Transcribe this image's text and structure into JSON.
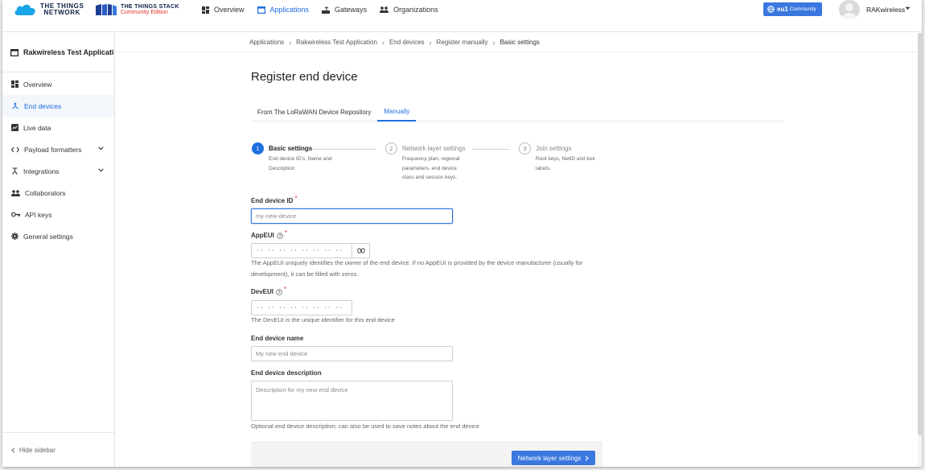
{
  "header": {
    "logo_ttn": [
      "THE THINGS",
      "NETWORK"
    ],
    "logo_tts": [
      "THE THINGS STACK",
      "Community Edition"
    ],
    "nav": [
      {
        "label": "Overview",
        "icon": "grid-icon"
      },
      {
        "label": "Applications",
        "icon": "application-icon",
        "active": true
      },
      {
        "label": "Gateways",
        "icon": "gateway-icon"
      },
      {
        "label": "Organizations",
        "icon": "organizations-icon"
      }
    ],
    "cluster_badge": {
      "region": "eu1",
      "label": "Community"
    },
    "user_name": "RAKwireless"
  },
  "sidebar": {
    "app_title": "Rakwireless Test Applicati...",
    "items": [
      {
        "label": "Overview",
        "icon": "grid-icon"
      },
      {
        "label": "End devices",
        "icon": "device-icon",
        "active": true
      },
      {
        "label": "Live data",
        "icon": "live-data-icon"
      },
      {
        "label": "Payload formatters",
        "icon": "code-icon",
        "expandable": true
      },
      {
        "label": "Integrations",
        "icon": "integrations-icon",
        "expandable": true
      },
      {
        "label": "Collaborators",
        "icon": "collaborators-icon"
      },
      {
        "label": "API keys",
        "icon": "key-icon"
      },
      {
        "label": "General settings",
        "icon": "gear-icon"
      }
    ],
    "hide_label": "Hide sidebar"
  },
  "breadcrumbs": [
    "Applications",
    "Rakwireless Test Application",
    "End devices",
    "Register manually",
    "Basic settings"
  ],
  "page_title": "Register end device",
  "tabs": [
    {
      "label": "From The LoRaWAN Device Repository"
    },
    {
      "label": "Manually",
      "active": true
    }
  ],
  "steps": [
    {
      "number": "1",
      "title": "Basic settings",
      "desc": [
        "End device ID's, Name and",
        "Description"
      ],
      "active": true
    },
    {
      "number": "2",
      "title": "Network layer settings",
      "desc": [
        "Frequency plan, regional",
        "parameters, end device",
        "class and session keys."
      ]
    },
    {
      "number": "3",
      "title": "Join settings",
      "desc": [
        "Root keys, NetID and kek",
        "labels."
      ]
    }
  ],
  "form": {
    "device_id": {
      "label": "End device ID",
      "placeholder": "my-new-device"
    },
    "app_eui": {
      "label": "AppEUI",
      "mask": "·· ·· ·· ·· ·· ·· ·· ··",
      "help": [
        "The AppEUI uniquely identifies the owner of the end device. If no AppEUI is provided by the device manufacturer (usually for",
        "development), it can be filled with zeros."
      ]
    },
    "dev_eui": {
      "label": "DevEUI",
      "mask": "·· ·· ·· ·· ·· ·· ·· ··",
      "help": "The DevEUI is the unique identifier for this end device"
    },
    "device_name": {
      "label": "End device name",
      "placeholder": "My new end device"
    },
    "device_desc": {
      "label": "End device description",
      "placeholder": "Description for my new end device",
      "help": "Optional end device description; can also be used to save notes about the end device"
    }
  },
  "next_button": "Network layer settings",
  "colors": {
    "accent": "#1f6fe0",
    "primary_button": "#3a78df",
    "required": "#e0352b"
  }
}
